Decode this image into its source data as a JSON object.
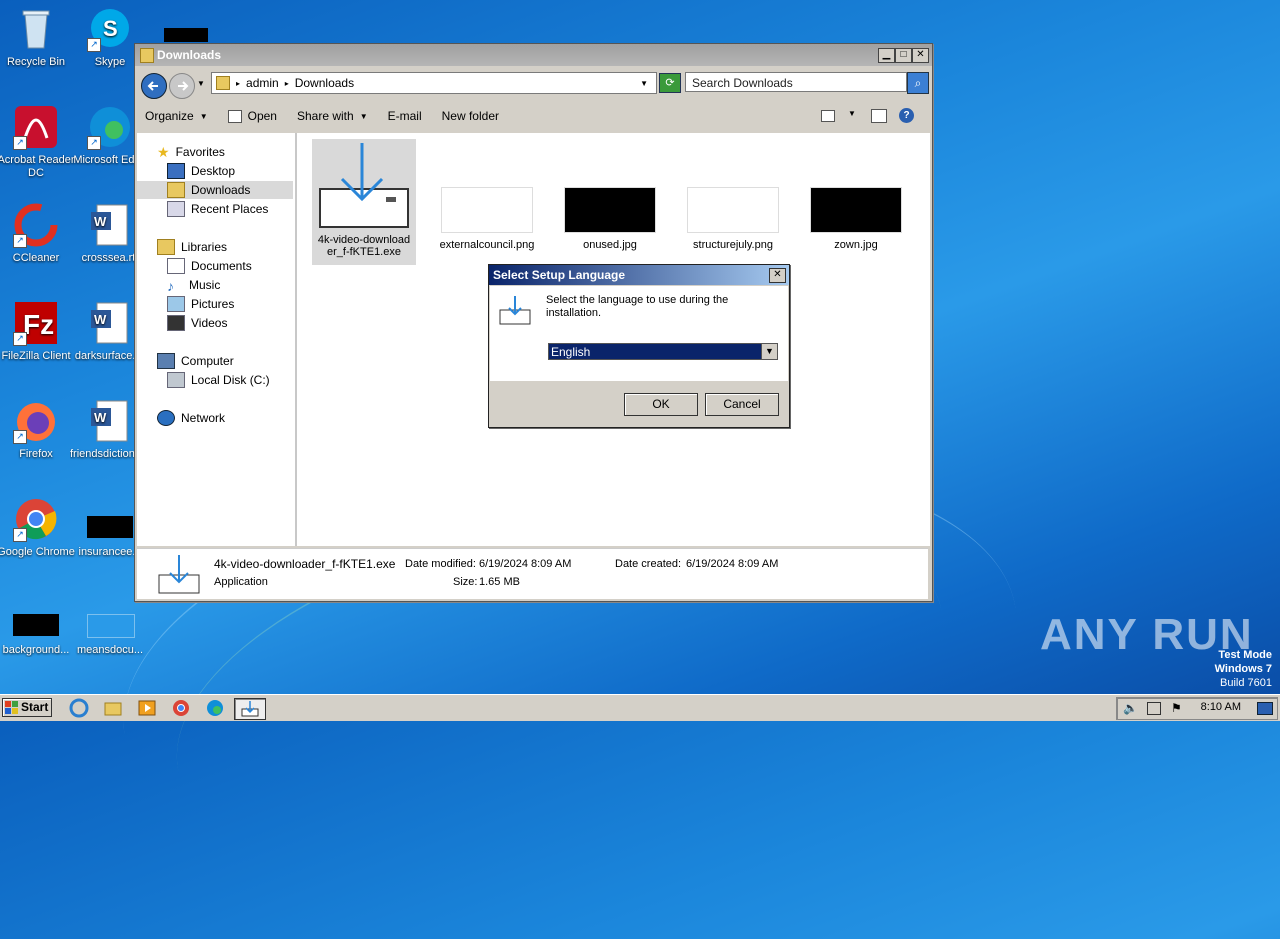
{
  "desktop": {
    "icons": [
      {
        "label": "Recycle Bin"
      },
      {
        "label": "Skype"
      },
      {
        "label": "Acrobat Reader DC"
      },
      {
        "label": "Microsoft Edge"
      },
      {
        "label": "CCleaner"
      },
      {
        "label": "crosssea.rtf"
      },
      {
        "label": "FileZilla Client"
      },
      {
        "label": "darksurface.rtf"
      },
      {
        "label": "Firefox"
      },
      {
        "label": "friendsdictionary.rtf"
      },
      {
        "label": "Google Chrome"
      },
      {
        "label": "insurancee..."
      },
      {
        "label": "background..."
      },
      {
        "label": "meansdocu..."
      }
    ]
  },
  "explorer": {
    "title": "Downloads",
    "address": {
      "part1": "admin",
      "part2": "Downloads"
    },
    "search_placeholder": "Search Downloads",
    "toolbar": {
      "organize": "Organize",
      "open": "Open",
      "share_with": "Share with",
      "email": "E-mail",
      "new_folder": "New folder"
    },
    "nav": {
      "favorites": "Favorites",
      "desktop": "Desktop",
      "downloads": "Downloads",
      "recent_places": "Recent Places",
      "libraries": "Libraries",
      "documents": "Documents",
      "music": "Music",
      "pictures": "Pictures",
      "videos": "Videos",
      "computer": "Computer",
      "local_disk": "Local Disk (C:)",
      "network": "Network"
    },
    "files": [
      {
        "name": "4k-video-downloader_f-fKTE1.exe",
        "name_line1": "4k-video-download",
        "name_line2": "er_f-fKTE1.exe"
      },
      {
        "name": "externalcouncil.png"
      },
      {
        "name": "onused.jpg"
      },
      {
        "name": "structurejuly.png"
      },
      {
        "name": "zown.jpg"
      }
    ],
    "details": {
      "filename": "4k-video-downloader_f-fKTE1.exe",
      "type": "Application",
      "date_modified_label": "Date modified:",
      "date_modified": "6/19/2024 8:09 AM",
      "date_created_label": "Date created:",
      "date_created": "6/19/2024 8:09 AM",
      "size_label": "Size:",
      "size": "1.65 MB"
    }
  },
  "dialog": {
    "title": "Select Setup Language",
    "message": "Select the language to use during the installation.",
    "message_line1": "Select the language to use during the",
    "message_line2": "installation.",
    "selected_language": "English",
    "ok": "OK",
    "cancel": "Cancel"
  },
  "taskbar": {
    "start": "Start",
    "clock": "8:10 AM"
  },
  "watermark": {
    "line1": "Test Mode",
    "line2": "Windows 7",
    "line3": "Build 7601",
    "brand": "ANY RUN"
  },
  "colors": {
    "desktop_blue": "#1b86db",
    "dialog_title": "#0a246a",
    "select_highlight": "#0a246a"
  }
}
